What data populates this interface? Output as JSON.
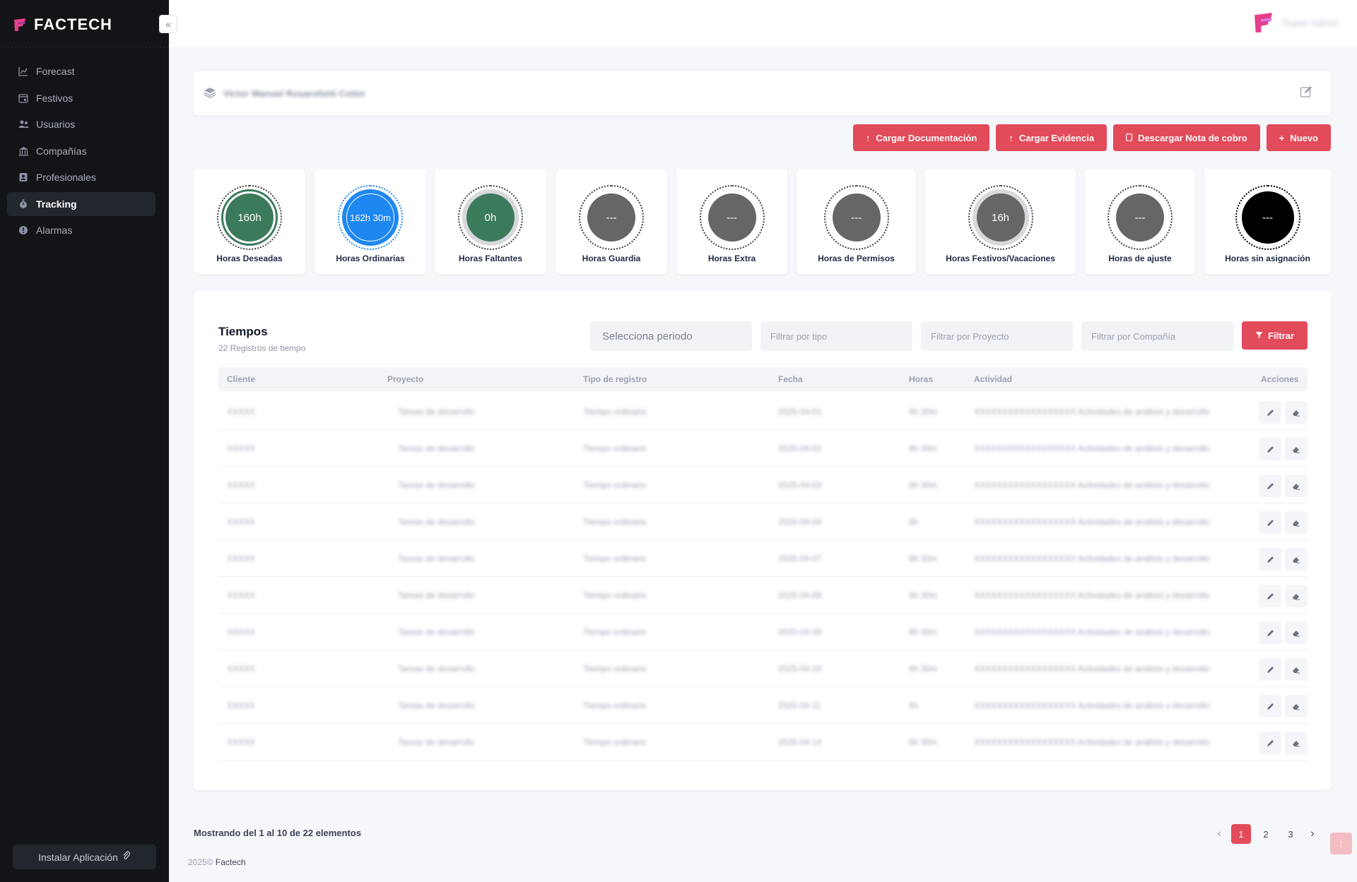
{
  "sidebar": {
    "brand": "FACTECH",
    "items": [
      {
        "label": "Forecast",
        "icon": "chart-line-icon",
        "active": false
      },
      {
        "label": "Festivos",
        "icon": "calendar-icon",
        "active": false
      },
      {
        "label": "Usuarios",
        "icon": "users-icon",
        "active": false
      },
      {
        "label": "Compañías",
        "icon": "building-icon",
        "active": false
      },
      {
        "label": "Profesionales",
        "icon": "id-badge-icon",
        "active": false
      },
      {
        "label": "Tracking",
        "icon": "stopwatch-icon",
        "active": true
      },
      {
        "label": "Alarmas",
        "icon": "alarm-icon",
        "active": false
      }
    ],
    "install_label": "Instalar Aplicación"
  },
  "header": {
    "user_name": "Super Admin"
  },
  "profile": {
    "name": "Victor Manuel Rosarolietti Colón"
  },
  "actions": {
    "cargar_documentacion": "Cargar Documentación",
    "cargar_evidencia": "Cargar Evidencia",
    "descargar_nota": "Descargar Nota de cobro",
    "nuevo": "Nuevo"
  },
  "stats": [
    {
      "label": "Horas Deseadas",
      "value": "160h",
      "color": "#3c7a5c"
    },
    {
      "label": "Horas Ordinarias",
      "value": "162h 30m",
      "color": "#1e88f0"
    },
    {
      "label": "Horas Faltantes",
      "value": "0h",
      "color": "#3c7a5c"
    },
    {
      "label": "Horas Guardia",
      "value": "---",
      "color": "#666666"
    },
    {
      "label": "Horas Extra",
      "value": "---",
      "color": "#666666"
    },
    {
      "label": "Horas de Permisos",
      "value": "---",
      "color": "#666666"
    },
    {
      "label": "Horas Festivos/Vacaciones",
      "value": "16h",
      "color": "#666666"
    },
    {
      "label": "Horas de ajuste",
      "value": "---",
      "color": "#666666"
    },
    {
      "label": "Horas sin asignación",
      "value": "---",
      "color": "#000000"
    }
  ],
  "table": {
    "title": "Tiempos",
    "subtitle": "22 Registros de tiempo",
    "filters": {
      "periodo": "Selecciona periodo",
      "tipo": "Filtrar por tipo",
      "proyecto": "Filtrar por Proyecto",
      "compania": "Filtrar por Compañía",
      "button": "Filtrar"
    },
    "headers": {
      "cliente": "Cliente",
      "proyecto": "Proyecto",
      "tipo": "Tipo de registro",
      "fecha": "Fecha",
      "horas": "Horas",
      "actividad": "Actividad",
      "acciones": "Acciones"
    },
    "rows": [
      {
        "cliente": "XXXXX",
        "proyecto": "Tareas de desarrollo",
        "tipo": "Tiempo ordinario",
        "fecha": "2025-04-01",
        "horas": "8h 30m",
        "actividad": "XXXXXXXXXXXXXXXXXX Actividades de análisis y desarrollo"
      },
      {
        "cliente": "XXXXX",
        "proyecto": "Tareas de desarrollo",
        "tipo": "Tiempo ordinario",
        "fecha": "2025-04-02",
        "horas": "8h 30m",
        "actividad": "XXXXXXXXXXXXXXXXXX Actividades de análisis y desarrollo"
      },
      {
        "cliente": "XXXXX",
        "proyecto": "Tareas de desarrollo",
        "tipo": "Tiempo ordinario",
        "fecha": "2025-04-03",
        "horas": "8h 30m",
        "actividad": "XXXXXXXXXXXXXXXXXX Actividades de análisis y desarrollo"
      },
      {
        "cliente": "XXXXX",
        "proyecto": "Tareas de desarrollo",
        "tipo": "Tiempo ordinario",
        "fecha": "2025-04-04",
        "horas": "6h",
        "actividad": "XXXXXXXXXXXXXXXXXX Actividades de análisis y desarrollo"
      },
      {
        "cliente": "XXXXX",
        "proyecto": "Tareas de desarrollo",
        "tipo": "Tiempo ordinario",
        "fecha": "2025-04-07",
        "horas": "8h 30m",
        "actividad": "XXXXXXXXXXXXXXXXXX Actividades de análisis y desarrollo"
      },
      {
        "cliente": "XXXXX",
        "proyecto": "Tareas de desarrollo",
        "tipo": "Tiempo ordinario",
        "fecha": "2025-04-08",
        "horas": "8h 30m",
        "actividad": "XXXXXXXXXXXXXXXXXX Actividades de análisis y desarrollo"
      },
      {
        "cliente": "XXXXX",
        "proyecto": "Tareas de desarrollo",
        "tipo": "Tiempo ordinario",
        "fecha": "2025-04-09",
        "horas": "8h 30m",
        "actividad": "XXXXXXXXXXXXXXXXXX Actividades de análisis y desarrollo"
      },
      {
        "cliente": "XXXXX",
        "proyecto": "Tareas de desarrollo",
        "tipo": "Tiempo ordinario",
        "fecha": "2025-04-10",
        "horas": "8h 30m",
        "actividad": "XXXXXXXXXXXXXXXXXX Actividades de análisis y desarrollo"
      },
      {
        "cliente": "XXXXX",
        "proyecto": "Tareas de desarrollo",
        "tipo": "Tiempo ordinario",
        "fecha": "2025-04-11",
        "horas": "6h",
        "actividad": "XXXXXXXXXXXXXXXXXX Actividades de análisis y desarrollo"
      },
      {
        "cliente": "XXXXX",
        "proyecto": "Tareas de desarrollo",
        "tipo": "Tiempo ordinario",
        "fecha": "2025-04-14",
        "horas": "8h 30m",
        "actividad": "XXXXXXXXXXXXXXXXXX Actividades de análisis y desarrollo"
      }
    ]
  },
  "pagination": {
    "showing": "Mostrando del 1 al 10 de 22 elementos",
    "pages": [
      "1",
      "2",
      "3"
    ],
    "current": "1"
  },
  "footer": {
    "year": "2025©",
    "brand": "Factech"
  },
  "colors": {
    "accent": "#e24b5a",
    "sidebar_bg": "#121418"
  }
}
